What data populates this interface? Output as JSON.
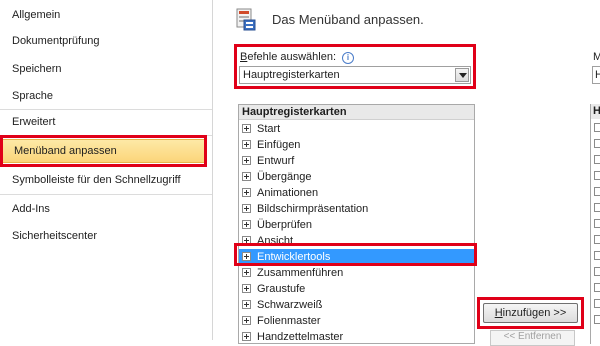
{
  "nav": {
    "items": [
      {
        "label": "Allgemein"
      },
      {
        "label": "Dokumentprüfung"
      },
      {
        "label": "Speichern"
      },
      {
        "label": "Sprache"
      },
      {
        "label": "Erweitert"
      },
      {
        "label": "Menüband anpassen",
        "selected": true
      },
      {
        "label": "Symbolleiste für den Schnellzugriff"
      },
      {
        "label": "Add-Ins"
      },
      {
        "label": "Sicherheitscenter"
      }
    ]
  },
  "header": {
    "title": "Das Menüband anpassen.",
    "icon": "customize-ribbon-icon"
  },
  "commands": {
    "label_underlined": "B",
    "label_rest": "efehle auswählen:",
    "info_icon": "i",
    "selected_value": "Hauptregisterkarten"
  },
  "tree": {
    "header": "Hauptregisterkarten",
    "items": [
      {
        "label": "Start"
      },
      {
        "label": "Einfügen"
      },
      {
        "label": "Entwurf"
      },
      {
        "label": "Übergänge"
      },
      {
        "label": "Animationen"
      },
      {
        "label": "Bildschirmpräsentation"
      },
      {
        "label": "Überprüfen"
      },
      {
        "label": "Ansicht"
      },
      {
        "label": "Entwicklertools",
        "selected": true
      },
      {
        "label": "Zusammenführen"
      },
      {
        "label": "Graustufe"
      },
      {
        "label": "Schwarzweiß"
      },
      {
        "label": "Folienmaster"
      },
      {
        "label": "Handzettelmaster"
      }
    ]
  },
  "buttons": {
    "add_underlined": "H",
    "add_rest": "inzufügen >>",
    "remove": "<< Entfernen"
  },
  "right": {
    "label": "M",
    "select_value": "Ha",
    "tree_header": "Ha"
  },
  "colors": {
    "highlight_red": "#e00018",
    "selected_nav": "#fbd57a",
    "selected_tree": "#3399ff"
  }
}
